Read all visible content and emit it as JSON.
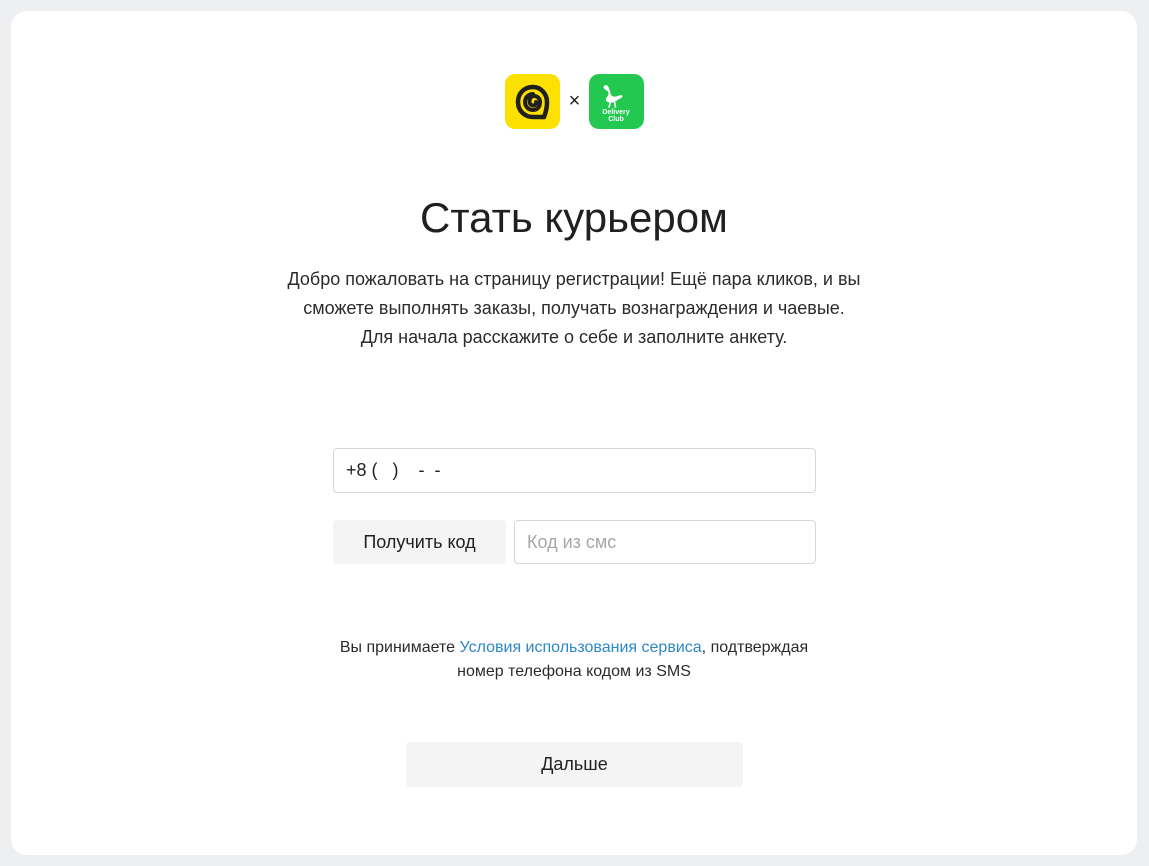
{
  "brand": {
    "separator": "×",
    "partner_logo_text_line1": "Delivery",
    "partner_logo_text_line2": "Club",
    "eda_color": "#fce000",
    "delivery_club_color": "#22c84f"
  },
  "page": {
    "title": "Стать курьером",
    "intro_line1": "Добро пожаловать на страницу регистрации! Ещё пара кликов, и вы",
    "intro_line2": "сможете выполнять заказы, получать вознаграждения и чаевые.",
    "intro_line3": "Для начала расскажите о себе и заполните анкету."
  },
  "form": {
    "phone_value": "+8 (   )    -  -",
    "get_code_label": "Получить код",
    "sms_placeholder": "Код из смс",
    "terms_prefix": "Вы принимаете ",
    "terms_link": "Условия использования сервиса",
    "terms_suffix_line1": ", подтверждая",
    "terms_line2": "номер телефона кодом из SMS",
    "next_label": "Дальше"
  },
  "colors": {
    "link": "#2d88c7",
    "button_bg": "#f4f4f4",
    "page_bg": "#eeeff1"
  }
}
